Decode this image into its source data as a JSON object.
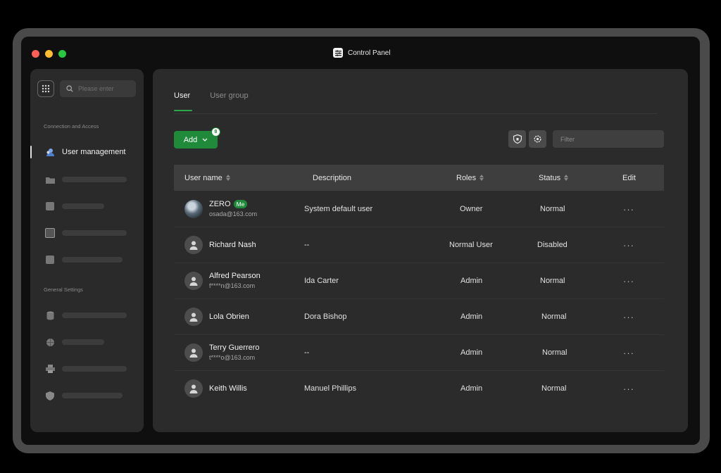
{
  "window": {
    "title": "Control Panel"
  },
  "colors": {
    "accent": "#1f8a3a",
    "background": "#2b2b2b",
    "sidebar": "#2a2a2a"
  },
  "sidebar": {
    "search_placeholder": "Please enter",
    "section1": "Connection and Access",
    "section2": "General Settings",
    "active_item": "User management"
  },
  "tabs": [
    {
      "label": "User",
      "active": true
    },
    {
      "label": "User group",
      "active": false
    }
  ],
  "toolbar": {
    "add_label": "Add",
    "add_badge": "8",
    "filter_placeholder": "Filter"
  },
  "table": {
    "headers": {
      "username": "User name",
      "description": "Description",
      "roles": "Roles",
      "status": "Status",
      "edit": "Edit"
    },
    "me_tag": "Me",
    "more": "···",
    "rows": [
      {
        "name": "ZERO",
        "email": "osada@163.com",
        "description": "System default user",
        "role": "Owner",
        "status": "Normal"
      },
      {
        "name": "Richard Nash",
        "email": "",
        "description": "--",
        "role": "Normal User",
        "status": "Disabled"
      },
      {
        "name": "Alfred Pearson",
        "email": "f****n@163.com",
        "description": "Ida Carter",
        "role": "Admin",
        "status": "Normal"
      },
      {
        "name": "Lola Obrien",
        "email": "",
        "description": "Dora Bishop",
        "role": "Admin",
        "status": "Normal"
      },
      {
        "name": "Terry Guerrero",
        "email": "t****o@163.com",
        "description": "--",
        "role": "Admin",
        "status": "Normal"
      },
      {
        "name": "Keith Willis",
        "email": "",
        "description": "Manuel Phillips",
        "role": "Admin",
        "status": "Normal"
      }
    ]
  }
}
